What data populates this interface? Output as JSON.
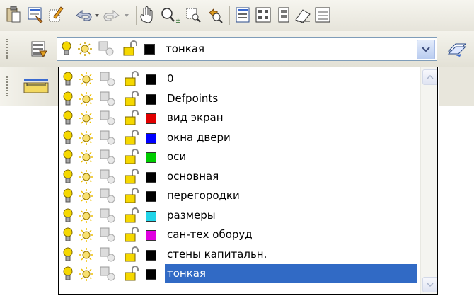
{
  "toolbar": {
    "icons": [
      "paste-icon",
      "match-properties-icon",
      "brush-icon",
      "undo-icon",
      "undo-dropdown-icon",
      "redo-icon",
      "redo-dropdown-icon",
      "pan-icon",
      "zoom-realtime-icon",
      "zoom-window-icon",
      "zoom-previous-icon",
      "properties-icon",
      "design-center-icon",
      "tool-palettes-icon",
      "sheet-set-icon",
      "markup-icon"
    ]
  },
  "layer_toolbar": {
    "manager_icon": "layer-manager-icon",
    "make_current_icon": "layer-previous-icon"
  },
  "current_layer": {
    "name": "тонкая",
    "color": "#000000"
  },
  "layers": [
    {
      "name": "0",
      "color": "#000000"
    },
    {
      "name": "Defpoints",
      "color": "#000000"
    },
    {
      "name": "вид экран",
      "color": "#e00000"
    },
    {
      "name": "окна двери",
      "color": "#0000ff"
    },
    {
      "name": "оси",
      "color": "#00cc00"
    },
    {
      "name": "основная",
      "color": "#000000"
    },
    {
      "name": "перегородки",
      "color": "#000000"
    },
    {
      "name": "размеры",
      "color": "#22d4e8"
    },
    {
      "name": "сан-тех оборуд",
      "color": "#e000e0"
    },
    {
      "name": "стены капитальн.",
      "color": "#000000"
    },
    {
      "name": "тонкая",
      "color": "#000000",
      "selected": true
    }
  ],
  "colors": {
    "selection": "#316ac5",
    "bulb_on": "#f5d800",
    "sun": "#f0c000"
  }
}
